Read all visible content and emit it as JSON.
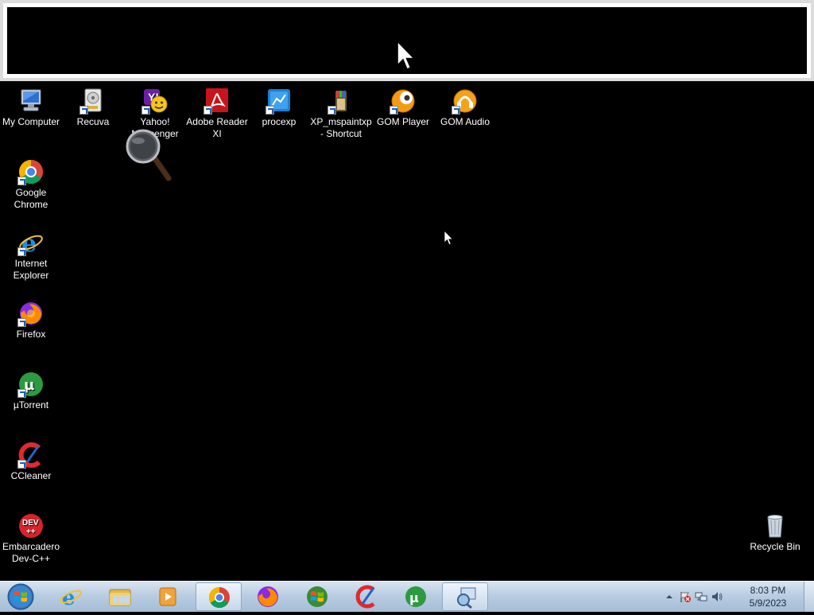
{
  "desktop": {
    "icons_top": [
      {
        "label": "My Computer",
        "icon": "computer-icon"
      },
      {
        "label": "Recuva",
        "icon": "recuva-icon"
      },
      {
        "label": "Yahoo! Messenger",
        "icon": "yahoo-messenger-icon"
      },
      {
        "label": "Adobe Reader XI",
        "icon": "adobe-reader-icon"
      },
      {
        "label": "procexp",
        "icon": "procexp-icon"
      },
      {
        "label": "XP_mspaintxp - Shortcut",
        "icon": "mspaint-icon"
      },
      {
        "label": "GOM Player",
        "icon": "gom-player-icon"
      },
      {
        "label": "GOM Audio",
        "icon": "gom-audio-icon"
      }
    ],
    "icons_left": [
      {
        "label": "Google Chrome",
        "icon": "chrome-icon"
      },
      {
        "label": "Internet Explorer",
        "icon": "internet-explorer-icon"
      },
      {
        "label": "Firefox",
        "icon": "firefox-icon"
      },
      {
        "label": "µTorrent",
        "icon": "utorrent-icon"
      },
      {
        "label": "CCleaner",
        "icon": "ccleaner-icon"
      },
      {
        "label": "Embarcadero Dev-C++",
        "icon": "devcpp-icon"
      }
    ],
    "recycle_bin": {
      "label": "Recycle Bin",
      "icon": "recycle-bin-icon"
    }
  },
  "taskbar": {
    "start": "windows-start-icon",
    "pinned": [
      "internet-explorer-icon",
      "file-explorer-icon",
      "media-player-icon",
      "chrome-icon",
      "firefox-icon",
      "windows-xp-icon",
      "ccleaner-icon",
      "utorrent-icon",
      "magnifier-icon"
    ],
    "active": [
      "chrome-icon",
      "magnifier-icon"
    ],
    "clock": {
      "time": "8:03 PM",
      "date": "5/9/2023"
    }
  },
  "colors": {
    "desktop_bg": "#000000",
    "taskbar_top": "#d8e4f0",
    "taskbar_bottom": "#a6bdd6"
  }
}
